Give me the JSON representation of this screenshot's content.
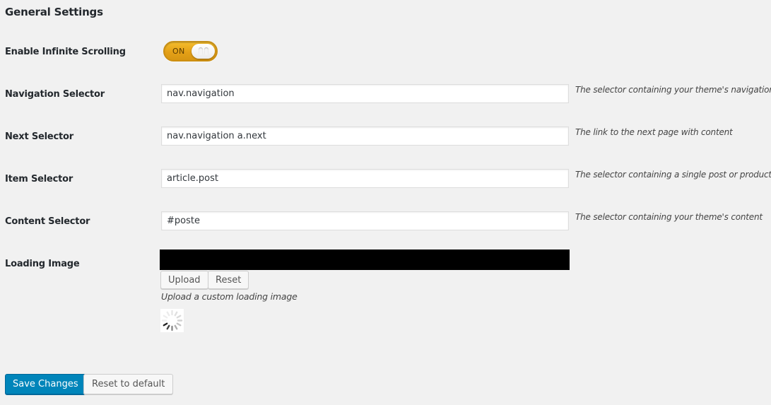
{
  "page": {
    "title": "General Settings"
  },
  "settings": {
    "infinite_scroll": {
      "label": "Enable Infinite Scrolling",
      "state_text": "ON",
      "enabled": true
    },
    "navigation_selector": {
      "label": "Navigation Selector",
      "value": "nav.navigation",
      "hint": "The selector containing your theme's navigation"
    },
    "next_selector": {
      "label": "Next Selector",
      "value": "nav.navigation a.next",
      "hint": "The link to the next page with content"
    },
    "item_selector": {
      "label": "Item Selector",
      "value": "article.post",
      "hint": "The selector containing a single post or product"
    },
    "content_selector": {
      "label": "Content Selector",
      "value": "#poste",
      "hint": "The selector containing your theme's content"
    },
    "loading_image": {
      "label": "Loading Image",
      "upload_label": "Upload",
      "reset_label": "Reset",
      "hint": "Upload a custom loading image"
    }
  },
  "actions": {
    "save_label": "Save Changes",
    "reset_default_label": "Reset to default"
  },
  "colors": {
    "toggle_on": "#e4a017",
    "primary_button": "#0085ba",
    "background": "#f1f1f1"
  }
}
